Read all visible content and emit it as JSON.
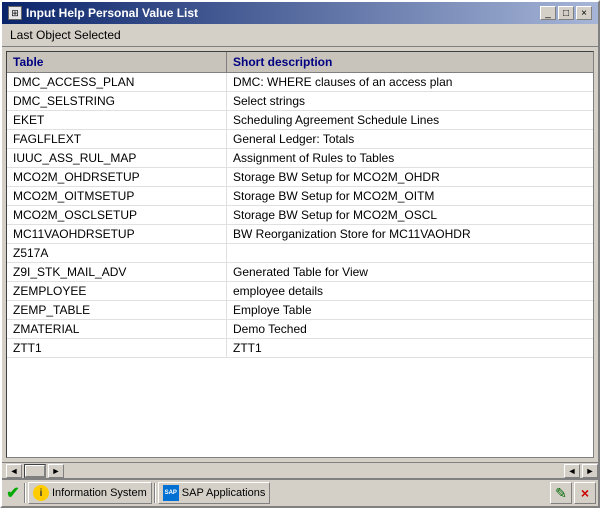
{
  "window": {
    "title": "Input Help Personal Value List",
    "close_label": "×",
    "min_label": "_",
    "max_label": "□"
  },
  "last_object": {
    "label": "Last Object Selected"
  },
  "table": {
    "col_table": "Table",
    "col_desc": "Short description",
    "rows": [
      {
        "table": "DMC_ACCESS_PLAN",
        "desc": "DMC: WHERE clauses of an access plan"
      },
      {
        "table": "DMC_SELSTRING",
        "desc": "Select strings"
      },
      {
        "table": "EKET",
        "desc": "Scheduling Agreement Schedule Lines"
      },
      {
        "table": "FAGLFLEXT",
        "desc": "General Ledger: Totals"
      },
      {
        "table": "IUUC_ASS_RUL_MAP",
        "desc": "Assignment of Rules to Tables"
      },
      {
        "table": "MCO2M_OHDRSETUP",
        "desc": "Storage BW Setup for MCO2M_OHDR"
      },
      {
        "table": "MCO2M_OITMSETUP",
        "desc": "Storage BW Setup for MCO2M_OITM"
      },
      {
        "table": "MCO2M_OSCLSETUP",
        "desc": "Storage BW Setup for MCO2M_OSCL"
      },
      {
        "table": "MC11VAOHDRSETUP",
        "desc": "BW Reorganization Store for MC11VAOHDR"
      },
      {
        "table": "Z517A",
        "desc": ""
      },
      {
        "table": "Z9I_STK_MAIL_ADV",
        "desc": "Generated Table for View"
      },
      {
        "table": "ZEMPLOYEE",
        "desc": "employee details"
      },
      {
        "table": "ZEMP_TABLE",
        "desc": "Employe Table"
      },
      {
        "table": "ZMATERIAL",
        "desc": "Demo Teched"
      },
      {
        "table": "ZTT1",
        "desc": "ZTT1"
      }
    ]
  },
  "statusbar": {
    "check_symbol": "✔",
    "info_system_label": "Information System",
    "sap_apps_label": "SAP Applications",
    "info_symbol": "i",
    "sap_symbol": "SAP",
    "scroll_left": "◄",
    "scroll_right": "►",
    "scroll_left2": "◄",
    "scroll_right2": "►",
    "pen_symbol": "✎",
    "close_symbol": "×"
  }
}
